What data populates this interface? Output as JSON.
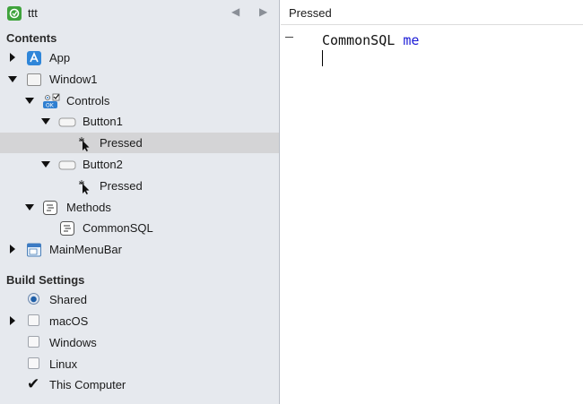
{
  "project": {
    "title": "ttt",
    "back_arrow": "◀",
    "forward_arrow": "▶"
  },
  "contents": {
    "heading": "Contents",
    "items": [
      {
        "label": "App",
        "icon": "app-icon",
        "expanded": false
      },
      {
        "label": "Window1",
        "icon": "window-icon",
        "expanded": true
      },
      {
        "label": "Controls",
        "icon": "controls-icon",
        "expanded": true
      },
      {
        "label": "Button1",
        "icon": "button-icon",
        "expanded": true
      },
      {
        "label": "Pressed",
        "icon": "event-cursor-icon",
        "selected": true
      },
      {
        "label": "Button2",
        "icon": "button-icon",
        "expanded": true
      },
      {
        "label": "Pressed",
        "icon": "event-cursor-icon"
      },
      {
        "label": "Methods",
        "icon": "methods-icon",
        "expanded": true
      },
      {
        "label": "CommonSQL",
        "icon": "method-icon"
      },
      {
        "label": "MainMenuBar",
        "icon": "menubar-icon",
        "expanded": false
      }
    ]
  },
  "build_settings": {
    "heading": "Build Settings",
    "items": [
      {
        "label": "Shared",
        "control": "radio",
        "checked": true
      },
      {
        "label": "macOS",
        "control": "checkbox",
        "checked": false,
        "has_disclosure": true
      },
      {
        "label": "Windows",
        "control": "checkbox",
        "checked": false
      },
      {
        "label": "Linux",
        "control": "checkbox",
        "checked": false
      },
      {
        "label": "This Computer",
        "control": "checkmark",
        "checked": true
      }
    ]
  },
  "editor": {
    "title": "Pressed",
    "code": {
      "identifier": "CommonSQL",
      "keyword": "me"
    }
  },
  "colors": {
    "selection": "#d4d4d6",
    "sidebar_bg": "#e6e9ee",
    "keyword_blue": "#1b1bd6"
  }
}
